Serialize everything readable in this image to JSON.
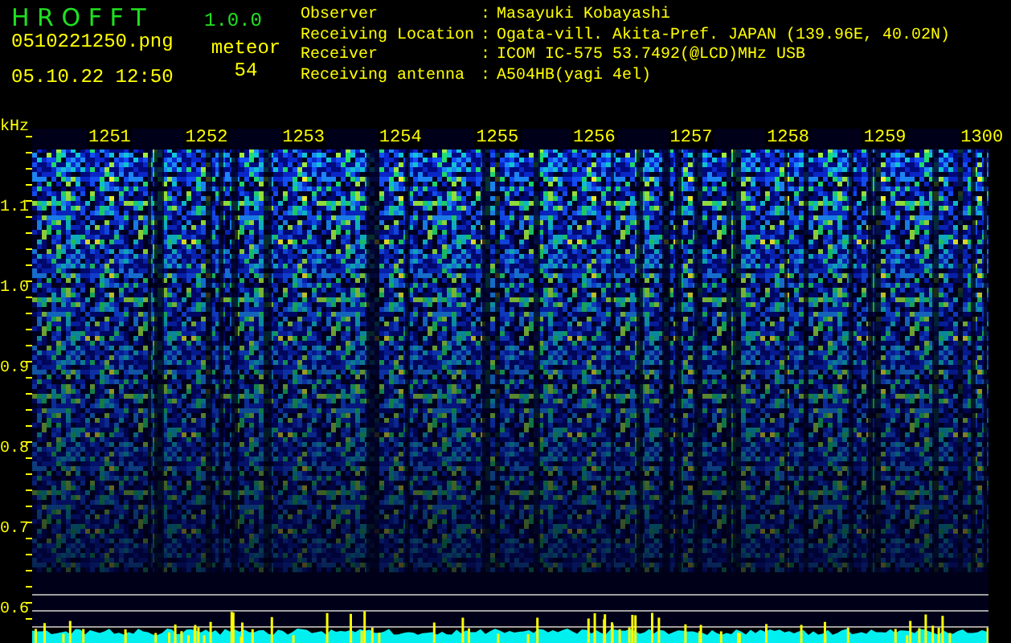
{
  "app": {
    "name": "H R O F F T",
    "version": "1.0.0"
  },
  "file": {
    "name": "0510221250.png",
    "datetime": "05.10.22 12:50"
  },
  "meteor": {
    "label": "meteor",
    "count": "54"
  },
  "info": [
    {
      "label": "Observer",
      "separator": ":",
      "value": "Masayuki Kobayashi"
    },
    {
      "label": "Receiving Location",
      "separator": ":",
      "value": "Ogata-vill. Akita-Pref. JAPAN (139.96E, 40.02N)"
    },
    {
      "label": "Receiver",
      "separator": ":",
      "value": "ICOM IC-575 53.7492(@LCD)MHz USB"
    },
    {
      "label": "Receiving antenna",
      "separator": ":",
      "value": "A504HB(yagi 4el)"
    }
  ],
  "spectrogram": {
    "unit": "kHz",
    "frequency_labels": [
      "1.1",
      "1.0",
      "0.9",
      "0.8",
      "0.7",
      "0.6"
    ],
    "time_labels": [
      "1251",
      "1252",
      "1253",
      "1254",
      "1255",
      "1256",
      "1257",
      "1258",
      "1259",
      "1300"
    ]
  }
}
